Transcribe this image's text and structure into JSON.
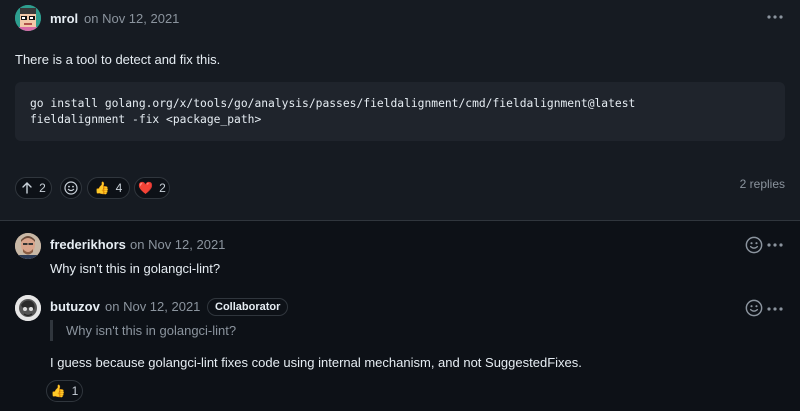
{
  "colors": {
    "background_top": "#161b22",
    "background_bottom": "#0d1117",
    "heart": "#f85149",
    "thumbs": "#f0b429"
  },
  "comment": {
    "author": "mrol",
    "date": "on Nov 12, 2021",
    "body": "There is a tool to detect and fix this.",
    "code": [
      "go install golang.org/x/tools/go/analysis/passes/fieldalignment/cmd/fieldalignment@latest",
      "fieldalignment -fix <package_path>"
    ],
    "reactions": [
      {
        "icon": "arrow-up-icon",
        "count": "2"
      },
      {
        "icon": "smiley-icon",
        "count": ""
      },
      {
        "icon": "thumbs-up-icon",
        "emoji": "👍",
        "count": "4"
      },
      {
        "icon": "heart-icon",
        "emoji": "❤️",
        "count": "2"
      }
    ],
    "replies_label": "2 replies"
  },
  "replies": [
    {
      "author": "frederikhors",
      "date": "on Nov 12, 2021",
      "body": "Why isn't this in golangci-lint?"
    },
    {
      "author": "butuzov",
      "date": "on Nov 12, 2021",
      "badge": "Collaborator",
      "quote": "Why isn't this in golangci-lint?",
      "body": "I guess because golangci-lint fixes code using internal mechanism, and not SuggestedFixes.",
      "reactions": [
        {
          "icon": "thumbs-up-icon",
          "emoji": "👍",
          "count": "1"
        }
      ]
    }
  ]
}
